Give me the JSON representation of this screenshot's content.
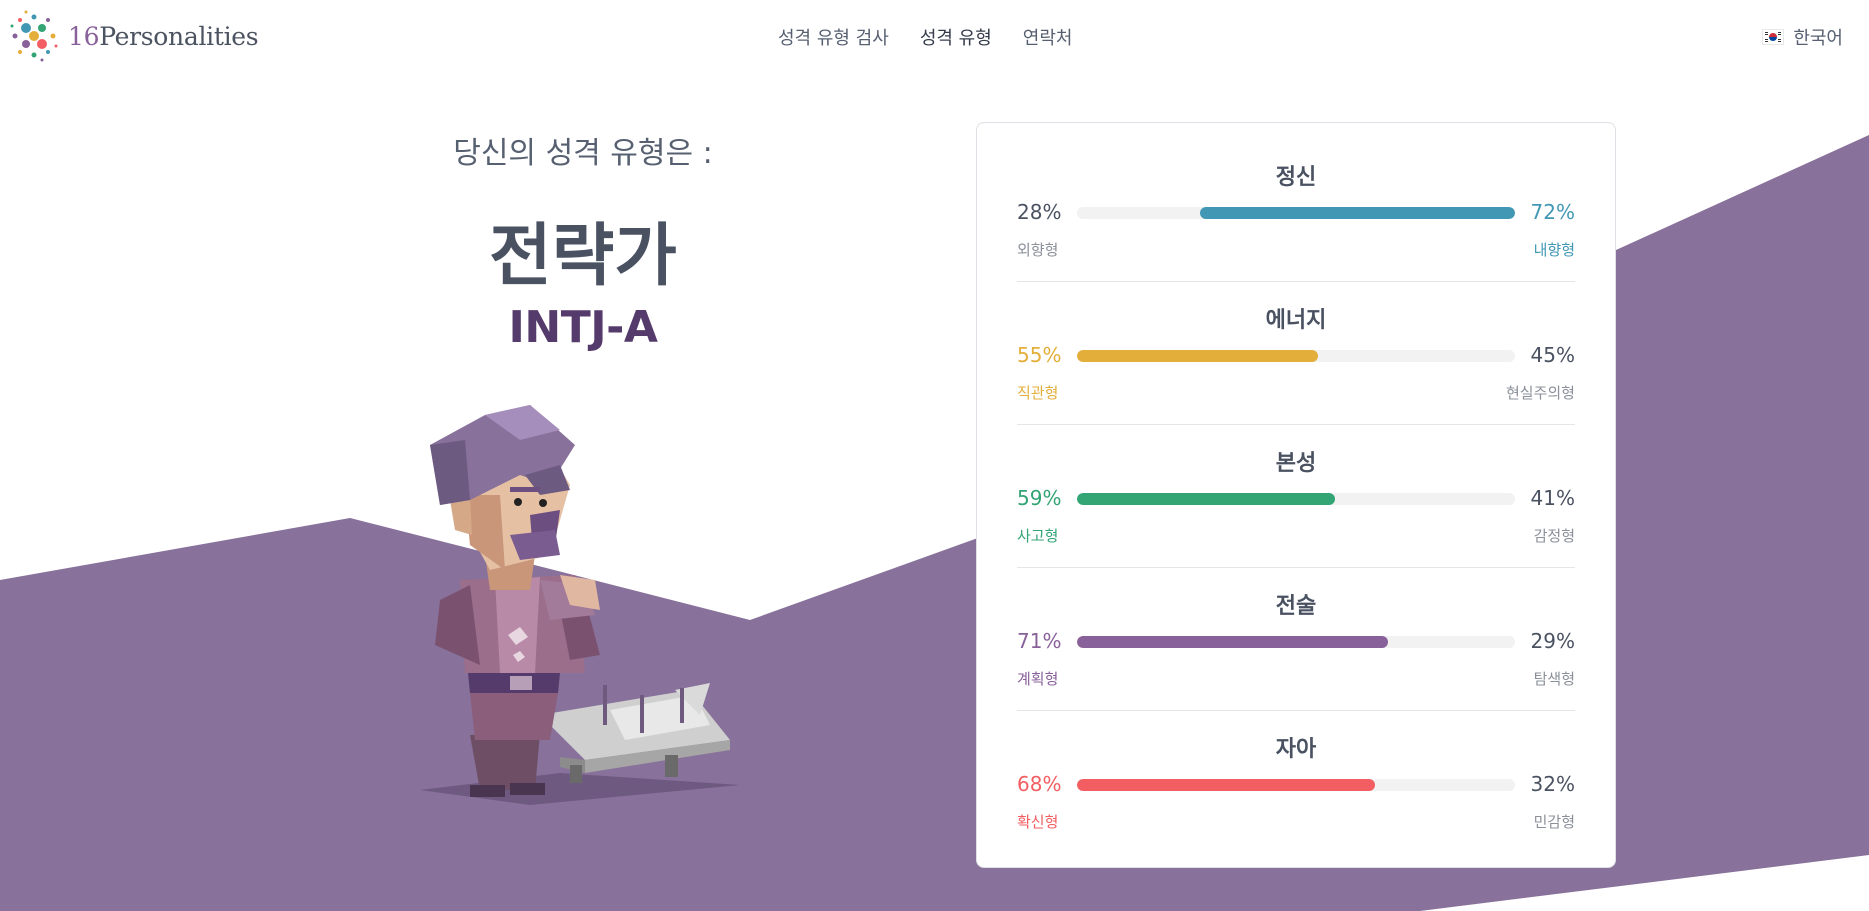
{
  "brand": {
    "number": "16",
    "name": "Personalities"
  },
  "nav": [
    {
      "label": "성격 유형 검사",
      "active": false
    },
    {
      "label": "성격 유형",
      "active": true
    },
    {
      "label": "연락처",
      "active": false
    }
  ],
  "language": {
    "label": "한국어",
    "flag_icon": "korea-flag-icon"
  },
  "result": {
    "subtitle": "당신의 성격 유형은 :",
    "type_name": "전략가",
    "type_code": "INTJ-A"
  },
  "colors": {
    "page_bg": "#ffffff",
    "purple_bg": "#88719a",
    "mind": "#4298b4",
    "energy": "#e4ae3a",
    "nature": "#33a474",
    "tactics": "#88619a",
    "identity": "#f25e62",
    "neutral_text": "#4a5262"
  },
  "traits": [
    {
      "title": "정신",
      "left_pct": "28%",
      "right_pct": "72%",
      "left_label": "외향형",
      "right_label": "내향형",
      "dominant": "right",
      "value": 0.72,
      "color_key": "mind"
    },
    {
      "title": "에너지",
      "left_pct": "55%",
      "right_pct": "45%",
      "left_label": "직관형",
      "right_label": "현실주의형",
      "dominant": "left",
      "value": 0.55,
      "color_key": "energy"
    },
    {
      "title": "본성",
      "left_pct": "59%",
      "right_pct": "41%",
      "left_label": "사고형",
      "right_label": "감정형",
      "dominant": "left",
      "value": 0.59,
      "color_key": "nature"
    },
    {
      "title": "전술",
      "left_pct": "71%",
      "right_pct": "29%",
      "left_label": "계획형",
      "right_label": "탐색형",
      "dominant": "left",
      "value": 0.71,
      "color_key": "tactics"
    },
    {
      "title": "자아",
      "left_pct": "68%",
      "right_pct": "32%",
      "left_label": "확신형",
      "right_label": "민감형",
      "dominant": "left",
      "value": 0.68,
      "color_key": "identity"
    }
  ]
}
